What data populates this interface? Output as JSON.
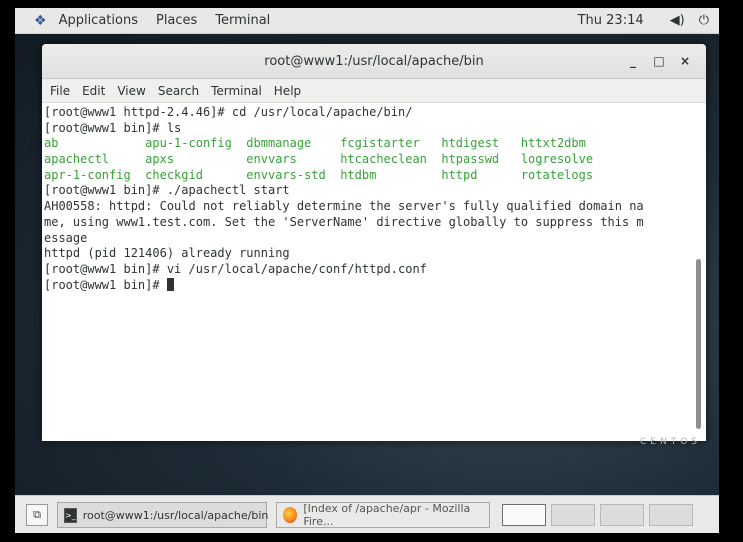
{
  "top_panel": {
    "applications": "Applications",
    "places": "Places",
    "terminal": "Terminal",
    "clock": "Thu 23:14",
    "volume_icon": "volume-icon",
    "power_icon": "power-icon"
  },
  "window": {
    "title": "root@www1:/usr/local/apache/bin",
    "minimize": "_",
    "maximize": "□",
    "close": "×"
  },
  "menu": {
    "file": "File",
    "edit": "Edit",
    "view": "View",
    "search": "Search",
    "terminal": "Terminal",
    "help": "Help"
  },
  "terminal": {
    "line1": "[root@www1 httpd-2.4.46]# cd /usr/local/apache/bin/",
    "line2": "[root@www1 bin]# ls",
    "ls_row1": "ab            apu-1-config  dbmmanage    fcgistarter   htdigest   httxt2dbm",
    "ls_row2": "apachectl     apxs          envvars      htcacheclean  htpasswd   logresolve",
    "ls_row3": "apr-1-config  checkgid      envvars-std  htdbm         httpd      rotatelogs",
    "line6": "[root@www1 bin]# ./apachectl start",
    "line7": "AH00558: httpd: Could not reliably determine the server's fully qualified domain na",
    "line8": "me, using www1.test.com. Set the 'ServerName' directive globally to suppress this m",
    "line9": "essage",
    "line10": "httpd (pid 121406) already running",
    "line11": "[root@www1 bin]# vi /usr/local/apache/conf/httpd.conf",
    "line12": "[root@www1 bin]# "
  },
  "desktop": {
    "watermark": "CENTOS"
  },
  "taskbar": {
    "task1": "root@www1:/usr/local/apache/bin",
    "task2": "[Index of /apache/apr - Mozilla Fire..."
  }
}
